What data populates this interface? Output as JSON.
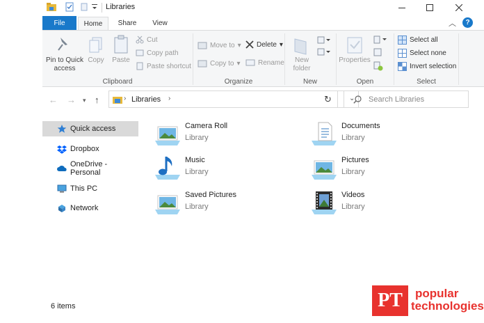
{
  "window": {
    "title": "Libraries",
    "minimize": "—",
    "maximize": "☐",
    "close": "✕"
  },
  "ribbon": {
    "tabs": [
      "File",
      "Home",
      "Share",
      "View"
    ],
    "active_tab": "Home",
    "help": "?",
    "clipboard": {
      "label": "Clipboard",
      "pin": "Pin to Quick access",
      "copy": "Copy",
      "paste": "Paste",
      "cut": "Cut",
      "copy_path": "Copy path",
      "paste_shortcut": "Paste shortcut"
    },
    "organize": {
      "label": "Organize",
      "move_to": "Move to",
      "copy_to": "Copy to",
      "delete": "Delete",
      "rename": "Rename"
    },
    "new": {
      "label": "New",
      "new_folder": "New folder"
    },
    "open": {
      "label": "Open",
      "properties": "Properties"
    },
    "select": {
      "label": "Select",
      "select_all": "Select all",
      "select_none": "Select none",
      "invert": "Invert selection"
    }
  },
  "address": {
    "path": "Libraries",
    "search_placeholder": "Search Libraries"
  },
  "nav_pane": {
    "items": [
      "Quick access",
      "Dropbox",
      "OneDrive - Personal",
      "This PC",
      "Network"
    ],
    "selected": "Quick access"
  },
  "libraries": [
    {
      "name": "Camera Roll",
      "type": "Library",
      "icon": "pictures-library-icon"
    },
    {
      "name": "Documents",
      "type": "Library",
      "icon": "documents-library-icon"
    },
    {
      "name": "Music",
      "type": "Library",
      "icon": "music-library-icon"
    },
    {
      "name": "Pictures",
      "type": "Library",
      "icon": "pictures-library-icon"
    },
    {
      "name": "Saved Pictures",
      "type": "Library",
      "icon": "pictures-library-icon"
    },
    {
      "name": "Videos",
      "type": "Library",
      "icon": "videos-library-icon"
    }
  ],
  "status": {
    "count": "6 items"
  },
  "watermark": {
    "logo": "PT",
    "line1": "popular",
    "line2": "technologies"
  },
  "colors": {
    "accent": "#1979ca",
    "selection": "#d9d9d9",
    "ribbon_bg": "#f5f6f7",
    "watermark_red": "#e8322e"
  }
}
